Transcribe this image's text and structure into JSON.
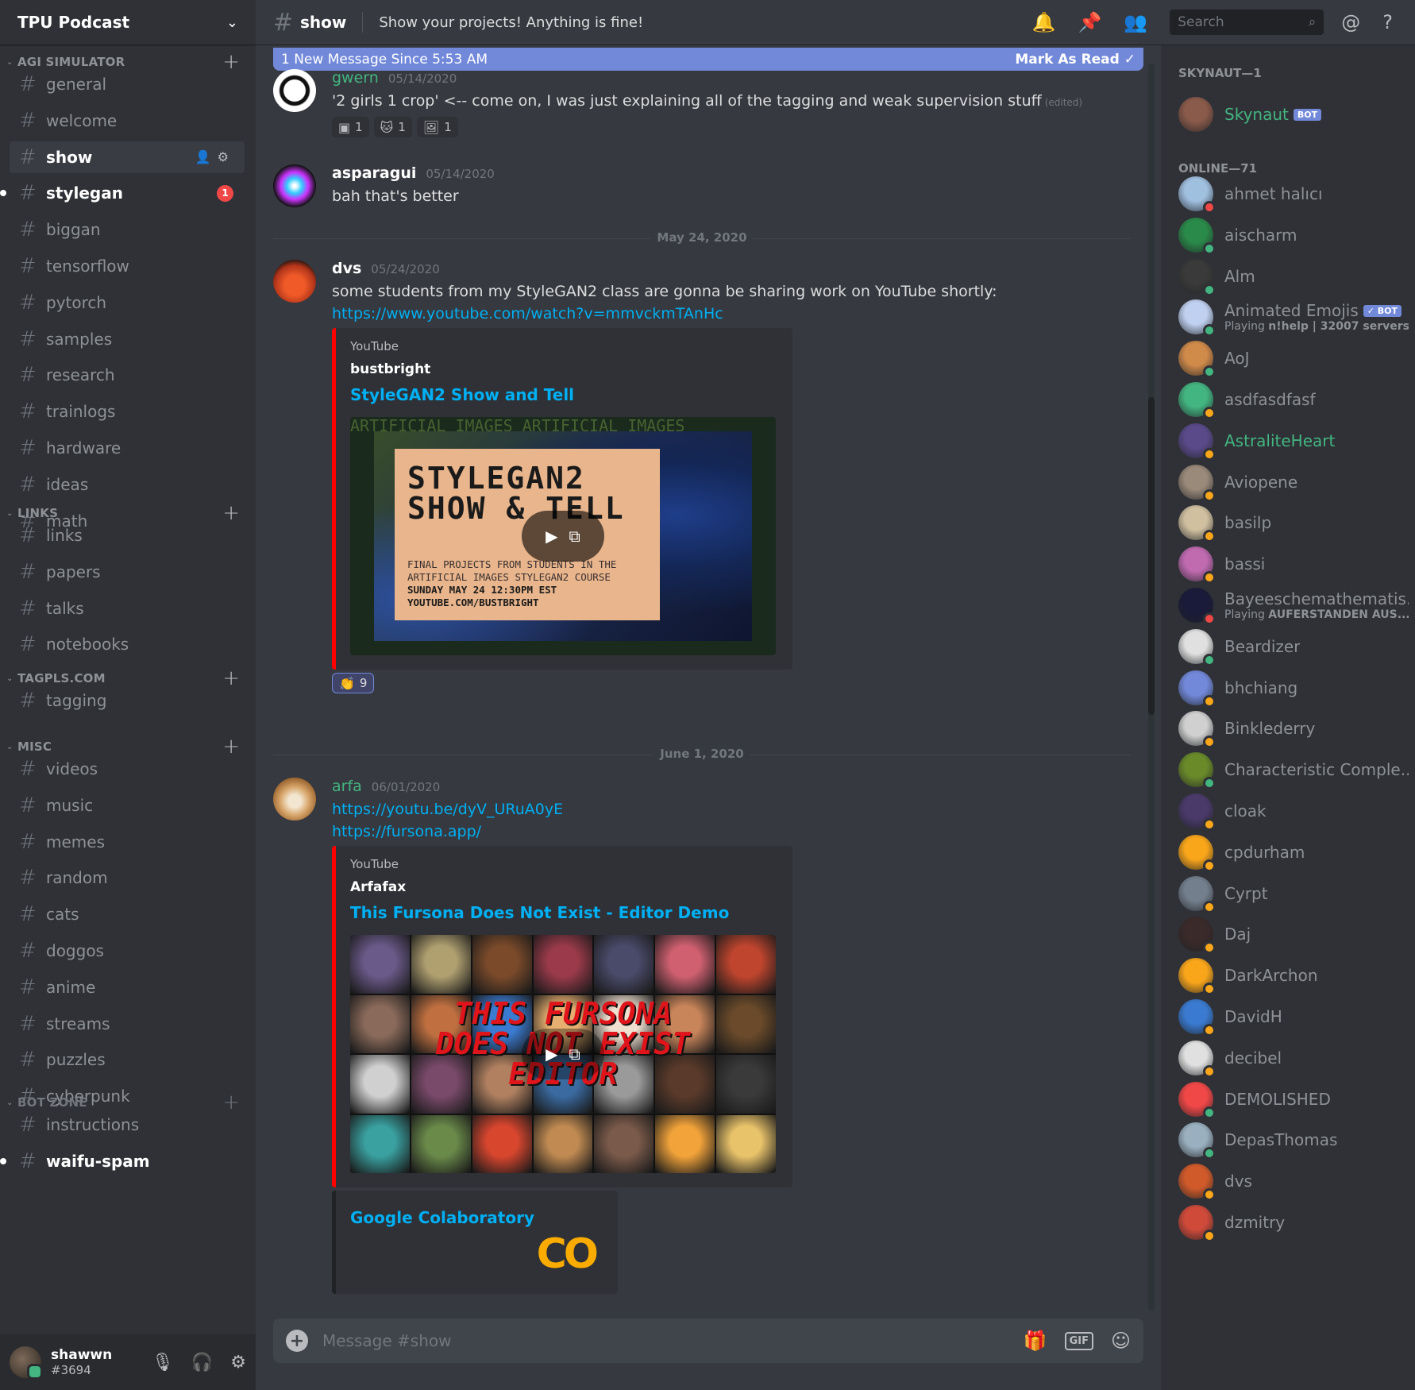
{
  "server": {
    "name": "TPU Podcast"
  },
  "categories": [
    {
      "name": "AGI SIMULATOR",
      "channels": [
        "general",
        "welcome",
        "show",
        "stylegan",
        "biggan",
        "tensorflow",
        "pytorch",
        "samples",
        "research",
        "trainlogs",
        "hardware",
        "ideas",
        "math"
      ]
    },
    {
      "name": "LINKS",
      "channels": [
        "links",
        "papers",
        "talks",
        "notebooks"
      ]
    },
    {
      "name": "TAGPLS.COM",
      "channels": [
        "tagging"
      ]
    },
    {
      "name": "MISC",
      "channels": [
        "videos",
        "music",
        "memes",
        "random",
        "cats",
        "doggos",
        "anime",
        "streams",
        "puzzles",
        "cyberpunk"
      ]
    },
    {
      "name": "BOT ZONE",
      "channels": [
        "instructions",
        "waifu-spam"
      ]
    }
  ],
  "active_channel": "show",
  "unread_badges": {
    "stylegan": "1"
  },
  "user": {
    "name": "shawwn",
    "discriminator": "#3694"
  },
  "header": {
    "channel": "show",
    "topic": "Show your projects! Anything is fine!",
    "search_placeholder": "Search"
  },
  "new_messages_bar": {
    "text": "1 New Message Since 5:53 AM",
    "action": "Mark As Read"
  },
  "messages": {
    "m1": {
      "author": "gwern",
      "timestamp": "05/14/2020",
      "text": "'2 girls 1 crop' <-- come on, I was just explaining all of the tagging and weak supervision stuff",
      "edited": "(edited)",
      "reactions": [
        {
          "emoji": "▣",
          "count": "1"
        },
        {
          "emoji": "🐱",
          "count": "1"
        },
        {
          "emoji": "🖼",
          "count": "1"
        }
      ]
    },
    "m2": {
      "author": "asparagui",
      "timestamp": "05/14/2020",
      "text": "bah that's better"
    },
    "divider1": "May 24, 2020",
    "m3": {
      "author": "dvs",
      "timestamp": "05/24/2020",
      "text": "some students from my StyleGAN2 class are gonna be sharing work on YouTube shortly:",
      "link": "https://www.youtube.com/watch?v=mmvckmTAnHc",
      "embed": {
        "provider": "YouTube",
        "author": "bustbright",
        "title": "StyleGAN2 Show and Tell",
        "thumb_title_1": "STYLEGAN2",
        "thumb_title_2": "SHOW & TELL",
        "thumb_line_1": "FINAL PROJECTS FROM STUDENTS IN THE",
        "thumb_line_2": "ARTIFICIAL IMAGES STYLEGAN2 COURSE",
        "thumb_line_3": "SUNDAY MAY 24 12:30PM EST",
        "thumb_line_4": "YOUTUBE.COM/BUSTBRIGHT",
        "thumb_border": "ARTIFICIAL IMAGES ARTIFICIAL IMAGES"
      },
      "reactions": [
        {
          "emoji": "👏",
          "count": "9"
        }
      ]
    },
    "divider2": "June 1, 2020",
    "m4": {
      "author": "arfa",
      "timestamp": "06/01/2020",
      "link1": "https://youtu.be/dyV_URuA0yE",
      "link2": "https://fursona.app/",
      "embed": {
        "provider": "YouTube",
        "author": "Arfafax",
        "title": "This Fursona Does Not Exist - Editor Demo",
        "thumb_text_1": "THIS FURSONA",
        "thumb_text_2": "DOES NOT EXIST",
        "thumb_text_3": "EDITOR"
      },
      "embed2": {
        "title": "Google Colaboratory",
        "logo": "CO"
      }
    }
  },
  "composer": {
    "placeholder": "Message #show",
    "gif_label": "GIF"
  },
  "members": {
    "bot_group": "SKYNAUT—1",
    "online_group": "ONLINE—71",
    "bot_label": "BOT",
    "verified_bot_label": "✓ BOT",
    "list": [
      {
        "name": "Skynaut",
        "bot": true,
        "color": "#43b581"
      },
      {
        "name": "ahmet halıcı",
        "status": "#f04747"
      },
      {
        "name": "aischarm",
        "status": "#43b581"
      },
      {
        "name": "Alm",
        "status": "#43b581"
      },
      {
        "name": "Animated Emojis",
        "bot": true,
        "verified": true,
        "activity_prefix": "Playing ",
        "activity": "n!help | 32007 servers",
        "status": "#43b581"
      },
      {
        "name": "AoJ",
        "status": "#43b581"
      },
      {
        "name": "asdfasdfasf",
        "status": "#faa61a"
      },
      {
        "name": "AstraliteHeart",
        "status": "#faa61a",
        "color": "#43b581"
      },
      {
        "name": "Aviopene",
        "status": "#faa61a"
      },
      {
        "name": "basilp",
        "status": "#faa61a"
      },
      {
        "name": "bassi",
        "status": "#faa61a"
      },
      {
        "name": "Bayeeschemathematis...",
        "activity_prefix": "Playing ",
        "activity": "AUFERSTANDEN AUS...",
        "status": "#f04747"
      },
      {
        "name": "Beardizer",
        "status": "#43b581"
      },
      {
        "name": "bhchiang",
        "status": "#faa61a"
      },
      {
        "name": "Binklederry",
        "status": "#faa61a"
      },
      {
        "name": "Characteristic Comple...",
        "status": "#43b581"
      },
      {
        "name": "cloak",
        "status": "#faa61a"
      },
      {
        "name": "cpdurham",
        "status": "#faa61a"
      },
      {
        "name": "Cyrpt",
        "status": "#faa61a"
      },
      {
        "name": "Daj",
        "status": "#faa61a"
      },
      {
        "name": "DarkArchon",
        "status": "#faa61a"
      },
      {
        "name": "DavidH",
        "status": "#faa61a"
      },
      {
        "name": "decibel",
        "status": "#faa61a"
      },
      {
        "name": "DEMOLISHED",
        "status": "#43b581"
      },
      {
        "name": "DepasThomas",
        "status": "#43b581"
      },
      {
        "name": "dvs",
        "status": "#faa61a"
      },
      {
        "name": "dzmitry",
        "status": "#faa61a"
      }
    ]
  },
  "colors": {
    "accent": "#7289da",
    "link": "#00b0f4",
    "online": "#43b581",
    "idle": "#faa61a",
    "dnd": "#f04747",
    "youtube": "#ff0000"
  }
}
